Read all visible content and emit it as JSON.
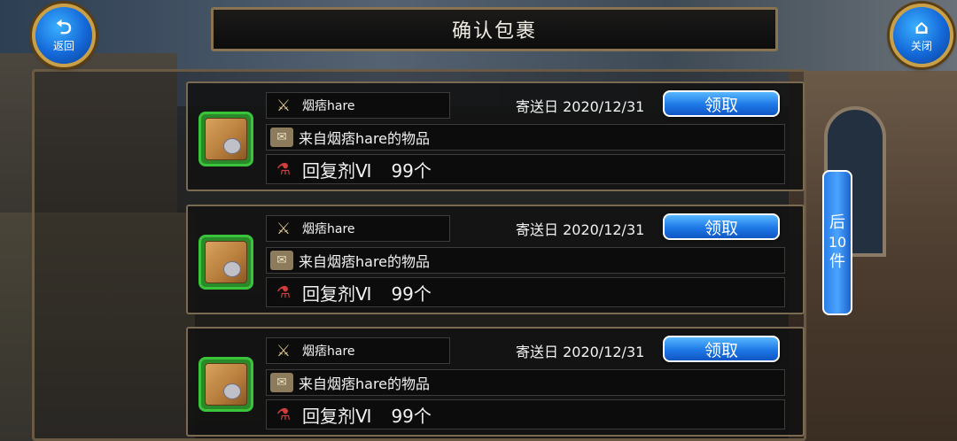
{
  "header": {
    "title": "确认包裹",
    "back_label": "返回",
    "close_label": "关闭"
  },
  "mails": [
    {
      "sender": "烟痞hare",
      "date_label": "寄送日 2020/12/31",
      "claim_label": "领取",
      "subject": "来自烟痞hare的物品",
      "item_name": "回复剂Ⅵ",
      "item_qty": "99个"
    },
    {
      "sender": "烟痞hare",
      "date_label": "寄送日 2020/12/31",
      "claim_label": "领取",
      "subject": "来自烟痞hare的物品",
      "item_name": "回复剂Ⅵ",
      "item_qty": "99个"
    },
    {
      "sender": "烟痞hare",
      "date_label": "寄送日 2020/12/31",
      "claim_label": "领取",
      "subject": "来自烟痞hare的物品",
      "item_name": "回复剂Ⅵ",
      "item_qty": "99个"
    }
  ],
  "pager": {
    "next_line1": "后",
    "next_line2": "10",
    "next_line3": "件"
  },
  "icons": {
    "back": "return-arrow-icon",
    "close": "home-icon",
    "sender": "crossed-swords-icon",
    "subject": "scroll-icon",
    "item": "potion-icon",
    "package": "crate-icon"
  },
  "colors": {
    "button_blue": "#1d78e6",
    "frame_gold": "#8a7350",
    "icon_green": "#2a8a2a"
  }
}
